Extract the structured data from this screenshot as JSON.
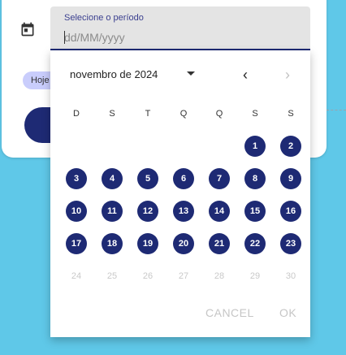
{
  "background": {
    "today_chip": "Hoje"
  },
  "date_field": {
    "label": "Selecione o período",
    "placeholder": "dd/MM/yyyy",
    "value": ""
  },
  "picker": {
    "month_label": "novembro de 2024",
    "weekdays": [
      "D",
      "S",
      "T",
      "Q",
      "Q",
      "S",
      "S"
    ],
    "weeks": [
      [
        "",
        "",
        "",
        "",
        "",
        "1",
        "2"
      ],
      [
        "3",
        "4",
        "5",
        "6",
        "7",
        "8",
        "9"
      ],
      [
        "10",
        "11",
        "12",
        "13",
        "14",
        "15",
        "16"
      ],
      [
        "17",
        "18",
        "19",
        "20",
        "21",
        "22",
        "23"
      ],
      [
        "24",
        "25",
        "26",
        "27",
        "28",
        "29",
        "30"
      ]
    ],
    "enabled_days": [
      "1",
      "2",
      "3",
      "4",
      "5",
      "6",
      "7",
      "8",
      "9",
      "10",
      "11",
      "12",
      "13",
      "14",
      "15",
      "16",
      "17",
      "18",
      "19",
      "20",
      "21",
      "22",
      "23"
    ],
    "cancel_label": "CANCEL",
    "ok_label": "OK"
  },
  "colors": {
    "accent": "#1e2a74",
    "page_background": "#5fc8e8",
    "chip": "#c9cdfc"
  }
}
